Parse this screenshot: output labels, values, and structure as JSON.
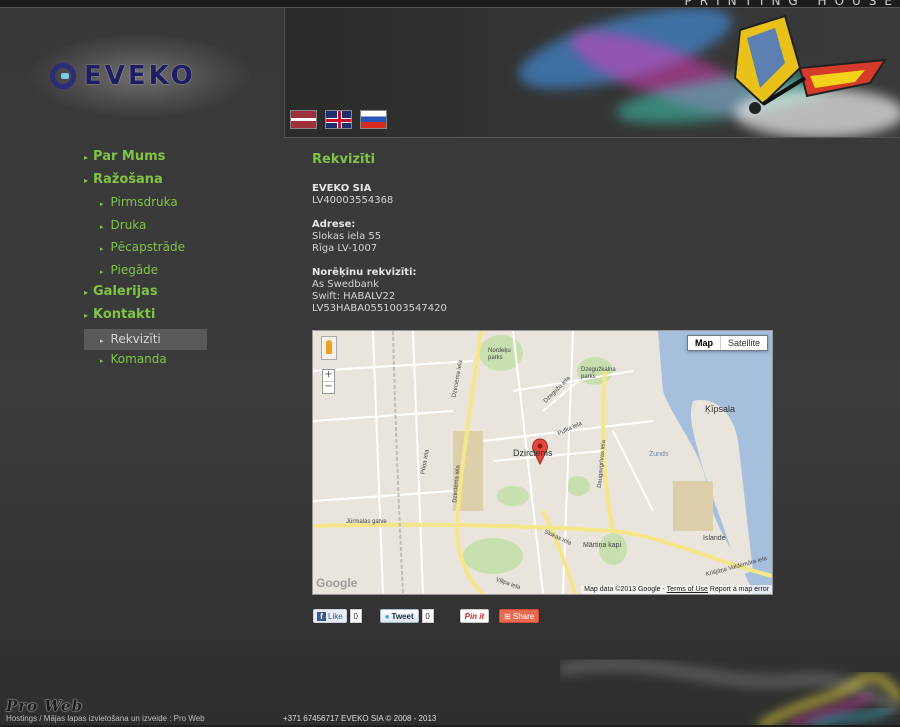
{
  "header": {
    "tagline": "PRINTING HOUSE",
    "logo_text": "EVEKO",
    "languages": [
      "Latviešu",
      "English",
      "Русский"
    ]
  },
  "nav": {
    "items": [
      {
        "label": "Par Mums"
      },
      {
        "label": "Ražošana",
        "children": [
          "Pirmsdruka",
          "Druka",
          "Pēcapstrāde",
          "Piegāde"
        ]
      },
      {
        "label": "Galerijas"
      },
      {
        "label": "Kontakti",
        "children": [
          "Rekvizīti",
          "Komanda"
        ]
      }
    ],
    "active": "Rekvizīti"
  },
  "content": {
    "title": "Rekvizīti",
    "company": {
      "name": "EVEKO SIA",
      "reg": "LV40003554368"
    },
    "address": {
      "label": "Adrese:",
      "line1": "Slokas iela 55",
      "line2": "Rīga LV-1007"
    },
    "bank": {
      "label": "Norēķinu rekvizīti:",
      "bank": "As Swedbank",
      "swift": "Swift: HABALV22",
      "account": "LV53HABA0551003547420"
    }
  },
  "map": {
    "type_buttons": [
      "Map",
      "Satellite"
    ],
    "selected_type": "Map",
    "zoom_in": "+",
    "zoom_out": "−",
    "marker_label": "Dzirciems",
    "labels": {
      "park1": "Nordeķu parks",
      "park2": "Dzegužkalna parks",
      "kipsala": "Ķīpsala",
      "daugava": "Zunds",
      "islande": "Islande",
      "martina": "Mārtiņa kapi",
      "road_dzirciema1": "Dzirciema iela",
      "road_dzirciema2": "Dzirciema iela",
      "road_dzeguzu": "Dzegužu iela",
      "road_pulka": "Pulka iela",
      "road_puna": "Pūņa iela",
      "road_daugavgrivas": "Daugavgrīvas iela",
      "road_jurmalas": "Jūrmalas gatve",
      "road_slokas": "Slokas iela",
      "road_vilipa": "Viļipa iela",
      "road_valdemara": "Krišjāņa Valdemāra iela"
    },
    "google": "Google",
    "attribution": "Map data ©2013 Google",
    "terms": "Terms of Use",
    "report": "Report a map error"
  },
  "share": {
    "like": "Like",
    "like_count": "0",
    "tweet": "Tweet",
    "tweet_count": "0",
    "pinit": "Pin it",
    "share": "Share"
  },
  "footer": {
    "brand": "Pro Web",
    "brand_sub": "Hostings / Mājas lapas izvietošana un izveide : Pro Web",
    "copyright": "+371 67456717 EVEKO SIA © 2008 - 2013"
  },
  "colors": {
    "accent": "#7fc444",
    "background": "#3a3a3a",
    "active_nav_bg": "#595959"
  }
}
